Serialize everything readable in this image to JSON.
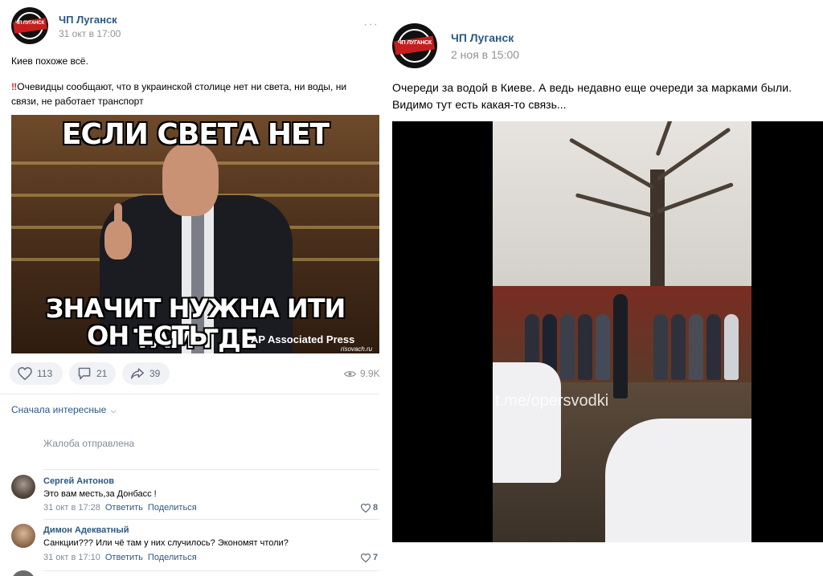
{
  "left_post": {
    "group_name": "ЧП Луганск",
    "avatar_text": "ЧП ЛУГАНСК",
    "time": "31 окт в 17:00",
    "more_icon": "more-dots-icon",
    "text_line1": "Киев похоже всё.",
    "text_line2": "Очевидцы сообщают, что в украинской столице нет ни света, ни воды, ни",
    "text_line3": "связи, не работает транспорт",
    "meme": {
      "caption_top": "ЕСЛИ СВЕТА НЕТ",
      "caption_bottom_1": "ЗНАЧИТ НУЖНА ИТИ ТАМ ГДЕ",
      "caption_bottom_2": "ОН ЕСТЬ",
      "watermark_ap": "AP Associated Press",
      "watermark_site": "risovach.ru"
    },
    "actions": {
      "likes": "113",
      "comments": "21",
      "shares": "39",
      "views": "9.9K"
    },
    "sort_label": "Сначала интересные",
    "complaint_text": "Жалоба отправлена",
    "comments": [
      {
        "author": "Сергей Антонов",
        "text": "Это вам месть,за Донбасс !",
        "time": "31 окт в 17:28",
        "reply": "Ответить",
        "share": "Поделиться",
        "likes": "8"
      },
      {
        "author": "Димон Адекватный",
        "text": "Санкции??? Или чё там у них случилось? Экономят чтоли?",
        "time": "31 окт в 17:10",
        "reply": "Ответить",
        "share": "Поделиться",
        "likes": "7"
      }
    ]
  },
  "right_post": {
    "group_name": "ЧП Луганск",
    "avatar_text": "ЧП ЛУГАНСК",
    "time": "2 ноя в 15:00",
    "text_line1": "Очереди за водой в Киеве. А ведь недавно еще очереди за марками были.",
    "text_line2": "Видимо тут есть какая-то связь...",
    "video_watermark": "t.me/opersvodki"
  },
  "colors": {
    "link": "#2a5885",
    "muted": "#939393",
    "pill_bg": "#f0f2f5"
  }
}
